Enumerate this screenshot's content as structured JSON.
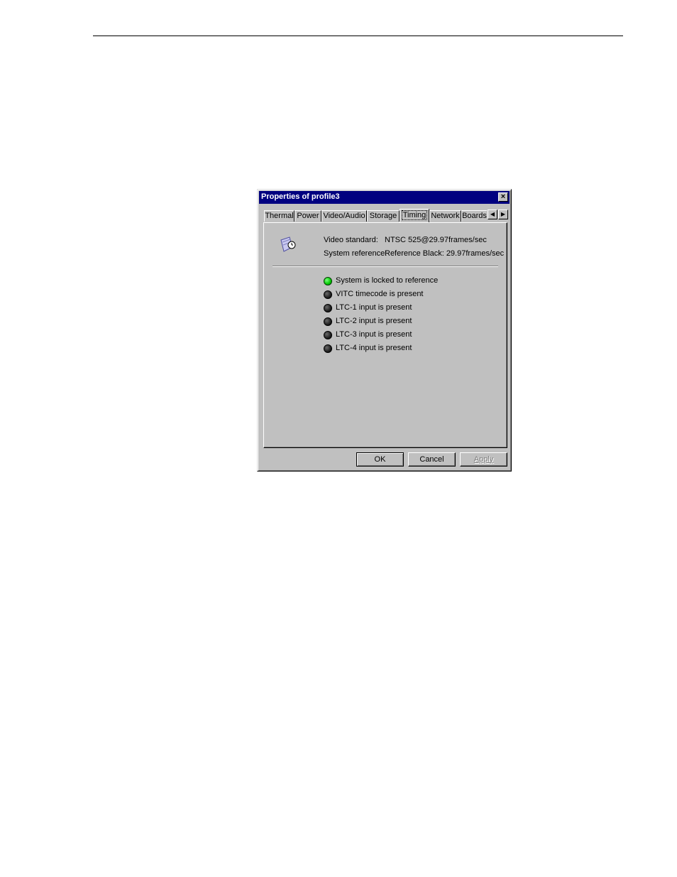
{
  "dialog": {
    "title": "Properties of profile3",
    "close_label": "×"
  },
  "tabs": [
    {
      "label": "Thermal"
    },
    {
      "label": "Power"
    },
    {
      "label": "Video/Audio"
    },
    {
      "label": "Storage"
    },
    {
      "label": "Timing",
      "active": true
    },
    {
      "label": "Network"
    },
    {
      "label": "Boards"
    }
  ],
  "tab_scroll": {
    "left": "◀",
    "right": "▶"
  },
  "timing": {
    "icon": "clock-flag-icon",
    "video_standard_label": "Video standard:",
    "video_standard_value": "NTSC 525@29.97frames/sec",
    "system_reference_label": "System reference:",
    "system_reference_value": "Reference Black: 29.97frames/sec",
    "statuses": [
      {
        "text": "System is locked to reference",
        "state": "on",
        "color": "#00c800"
      },
      {
        "text": "VITC timecode is present",
        "state": "off",
        "color": "#202020"
      },
      {
        "text": "LTC-1 input is present",
        "state": "off",
        "color": "#202020"
      },
      {
        "text": "LTC-2 input is present",
        "state": "off",
        "color": "#202020"
      },
      {
        "text": "LTC-3 input is present",
        "state": "off",
        "color": "#202020"
      },
      {
        "text": "LTC-4 input is present",
        "state": "off",
        "color": "#202020"
      }
    ]
  },
  "buttons": {
    "ok": "OK",
    "cancel": "Cancel",
    "apply": "Apply"
  },
  "colors": {
    "titlebar": "#000080",
    "face": "#c0c0c0"
  }
}
